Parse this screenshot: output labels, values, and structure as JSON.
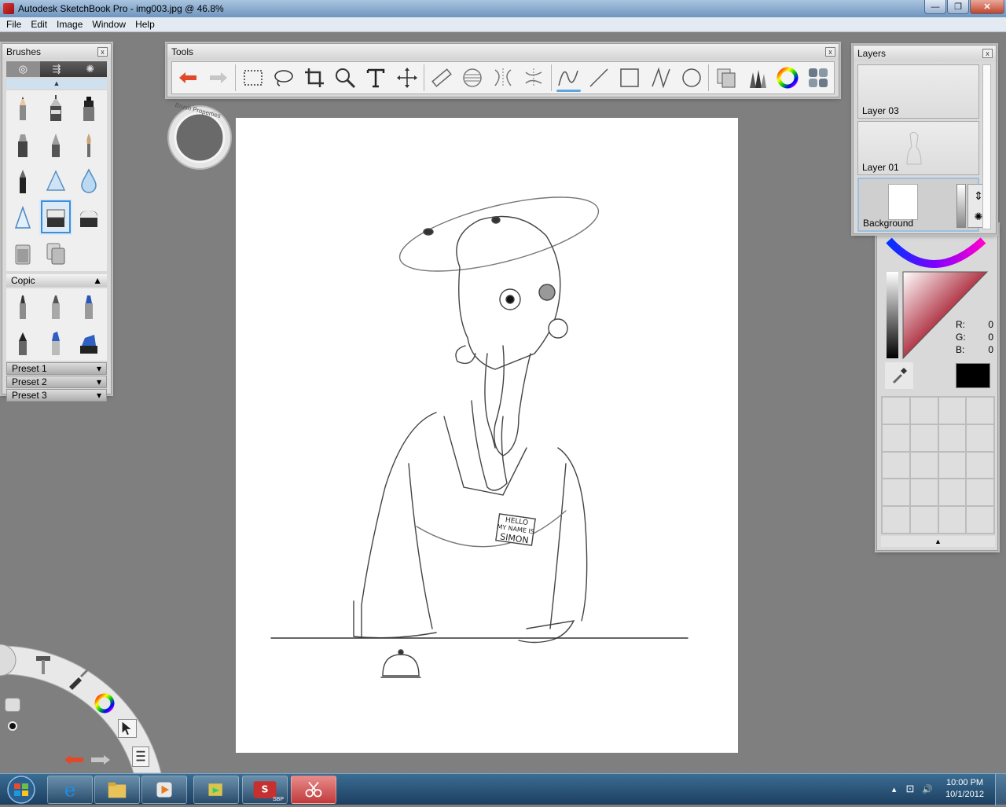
{
  "window": {
    "title": "Autodesk SketchBook Pro - img003.jpg @ 46.8%",
    "minimize_glyph": "—",
    "maximize_glyph": "❐",
    "close_glyph": "✕"
  },
  "menubar": {
    "items": [
      "File",
      "Edit",
      "Image",
      "Window",
      "Help"
    ]
  },
  "brushes_palette": {
    "title": "Brushes",
    "close_glyph": "x",
    "tabs": [
      "◎",
      "⇶",
      "✺"
    ],
    "section": "Copic",
    "presets": [
      "Preset 1",
      "Preset 2",
      "Preset 3"
    ],
    "dropdown_glyph": "▾",
    "collapse_glyph": "▲"
  },
  "tools_palette": {
    "title": "Tools",
    "close_glyph": "x",
    "tools": [
      "undo-icon",
      "redo-icon",
      "rect-select-icon",
      "lasso-icon",
      "crop-icon",
      "zoom-icon",
      "text-icon",
      "transform-icon",
      "ruler-icon",
      "ellipse-guide-icon",
      "symmetry-icon",
      "symmetry-y-icon",
      "curve-icon",
      "line-icon",
      "rectangle-icon",
      "polyline-icon",
      "ellipse-icon",
      "copy-icon",
      "brush-palette-icon",
      "color-wheel-icon",
      "palettes-icon"
    ]
  },
  "layers_palette": {
    "title": "Layers",
    "close_glyph": "x",
    "layers": [
      {
        "name": "Layer 03"
      },
      {
        "name": "Layer 01"
      },
      {
        "name": "Background"
      }
    ]
  },
  "color_panel": {
    "r_label": "R:",
    "r_value": "0",
    "g_label": "G:",
    "g_value": "0",
    "b_label": "B:",
    "b_value": "0",
    "current_color": "#000000",
    "expand_glyph": "▲"
  },
  "brush_puck": {
    "label": "Brush Properties"
  },
  "canvas": {
    "name_tag": [
      "HELLO",
      "MY NAME IS",
      "SIMON"
    ]
  },
  "taskbar": {
    "time": "10:00 PM",
    "date": "10/1/2012",
    "sbp_label": "SBP",
    "tray_glyphs": [
      "▴",
      "⊡",
      "🔊"
    ]
  }
}
